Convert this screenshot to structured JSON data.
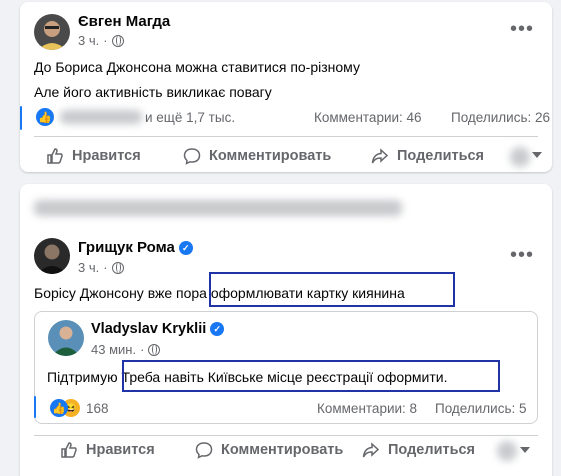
{
  "post1": {
    "author": "Євген Магда",
    "time": "3 ч.",
    "line1": "До Бориса Джонсона можна ставитися по-різному",
    "line2": "Але його активність викликає повагу",
    "likes_text": "и ещё 1,7 тыс.",
    "comments": "Комментарии: 46",
    "shares": "Поделились: 26",
    "actions": {
      "like": "Нравится",
      "comment": "Комментировать",
      "share": "Поделиться"
    }
  },
  "post2": {
    "author": "Грищук Рома",
    "time": "3 ч.",
    "text_prefix": "Борісу Джонсону вже пора ",
    "text_highlight": "оформлювати картку киянина",
    "shared": {
      "author": "Vladyslav Kryklii",
      "time": "43 мин.",
      "text_prefix": "Підтримую ",
      "text_highlight": "Треба навіть Київське місце реєстрації оформити.",
      "reactions": "168",
      "comments": "Комментарии: 8",
      "shares": "Поделились: 5"
    },
    "actions": {
      "like": "Нравится",
      "comment": "Комментировать",
      "share": "Поделиться"
    }
  },
  "colors": {
    "accent": "#1877f2",
    "highlight_border": "#1f33a6",
    "muted": "#65676b"
  }
}
